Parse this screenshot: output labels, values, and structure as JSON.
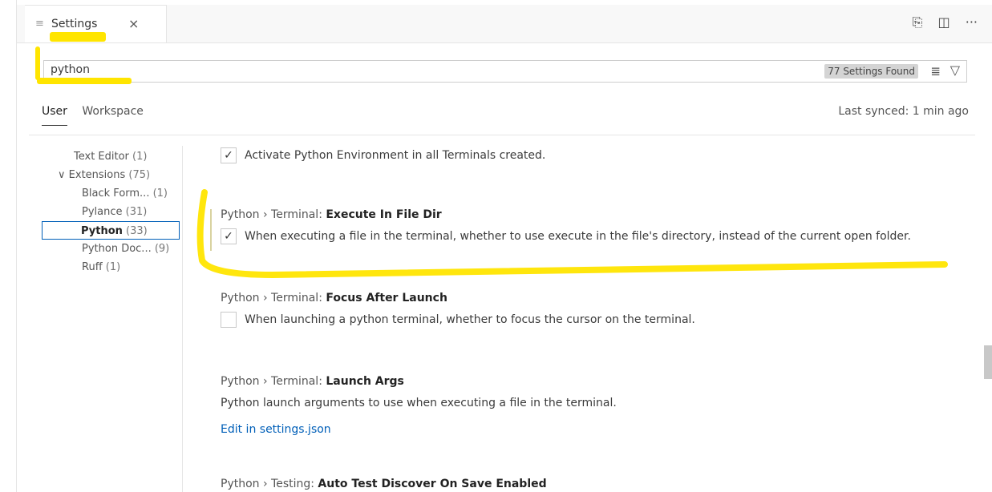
{
  "tab": {
    "label": "Settings",
    "close": "×",
    "icon": "list-icon"
  },
  "tab_actions": {
    "open_json": "⎘",
    "split": "◫",
    "more": "···"
  },
  "search": {
    "value": "python",
    "results": "77 Settings Found"
  },
  "scope": {
    "user": "User",
    "workspace": "Workspace",
    "synced": "Last synced: 1 min ago"
  },
  "toc": [
    {
      "label": "Text Editor",
      "count": "(1)"
    },
    {
      "label": "Extensions",
      "count": "(75)",
      "chevron": "∨"
    },
    {
      "label": "Black Form...",
      "count": "(1)"
    },
    {
      "label": "Pylance",
      "count": "(31)"
    },
    {
      "label": "Python",
      "count": "(33)"
    },
    {
      "label": "Python Doc...",
      "count": "(9)"
    },
    {
      "label": "Ruff",
      "count": "(1)"
    }
  ],
  "settings": {
    "activate": {
      "desc": "Activate Python Environment in all Terminals created.",
      "checked": true
    },
    "execute": {
      "category": "Python › Terminal: ",
      "name": "Execute In File Dir",
      "desc": "When executing a file in the terminal, whether to use execute in the file's directory, instead of the current open folder.",
      "checked": true
    },
    "focus": {
      "category": "Python › Terminal: ",
      "name": "Focus After Launch",
      "desc": "When launching a python terminal, whether to focus the cursor on the terminal.",
      "checked": false
    },
    "launch": {
      "category": "Python › Terminal: ",
      "name": "Launch Args",
      "desc": "Python launch arguments to use when executing a file in the terminal.",
      "link": "Edit in settings.json"
    },
    "testing": {
      "category": "Python › Testing: ",
      "name": "Auto Test Discover On Save Enabled"
    }
  },
  "colors": {
    "highlight": "#ffe500",
    "accent": "#005fb8"
  }
}
